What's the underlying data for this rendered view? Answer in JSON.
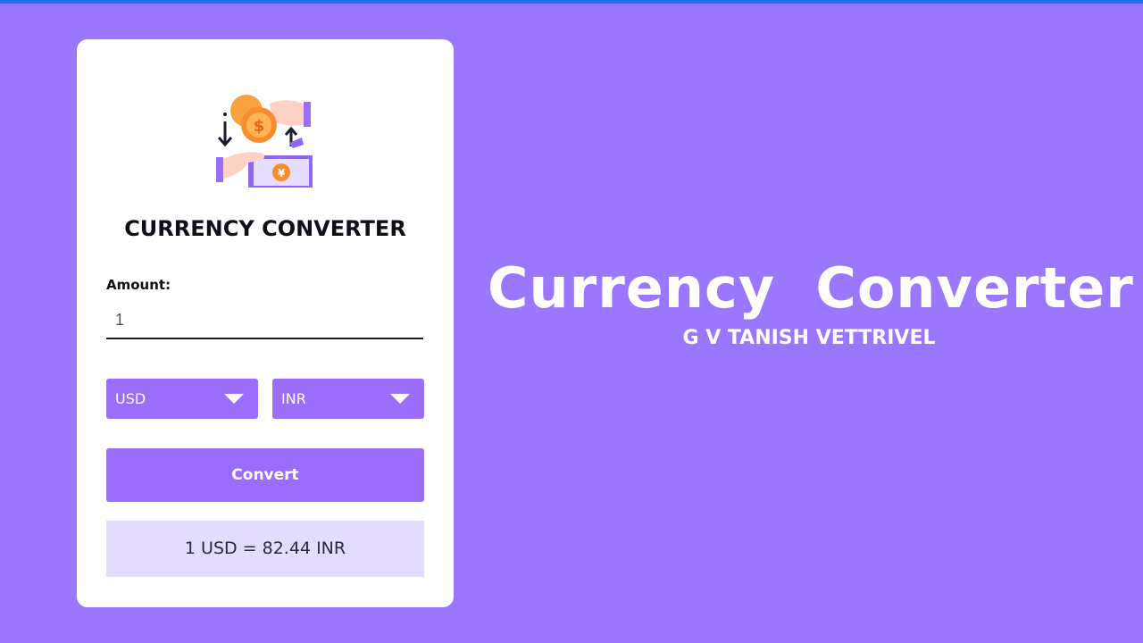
{
  "colors": {
    "background": "#9b77fd",
    "top_bar": "#1f6fe6",
    "accent": "#9b6dfb",
    "result_bg": "#e4dcff",
    "card_bg": "#ffffff"
  },
  "logo": {
    "icon": "currency-exchange-icon"
  },
  "card": {
    "title": "CURRENCY CONVERTER",
    "amount_label": "Amount:",
    "amount_value": "1",
    "from_currency": "USD",
    "to_currency": "INR",
    "convert_label": "Convert",
    "result_text": "1 USD = 82.44 INR"
  },
  "hero": {
    "title": "Currency  Converter",
    "subtitle": "G V TANISH VETTRIVEL"
  }
}
